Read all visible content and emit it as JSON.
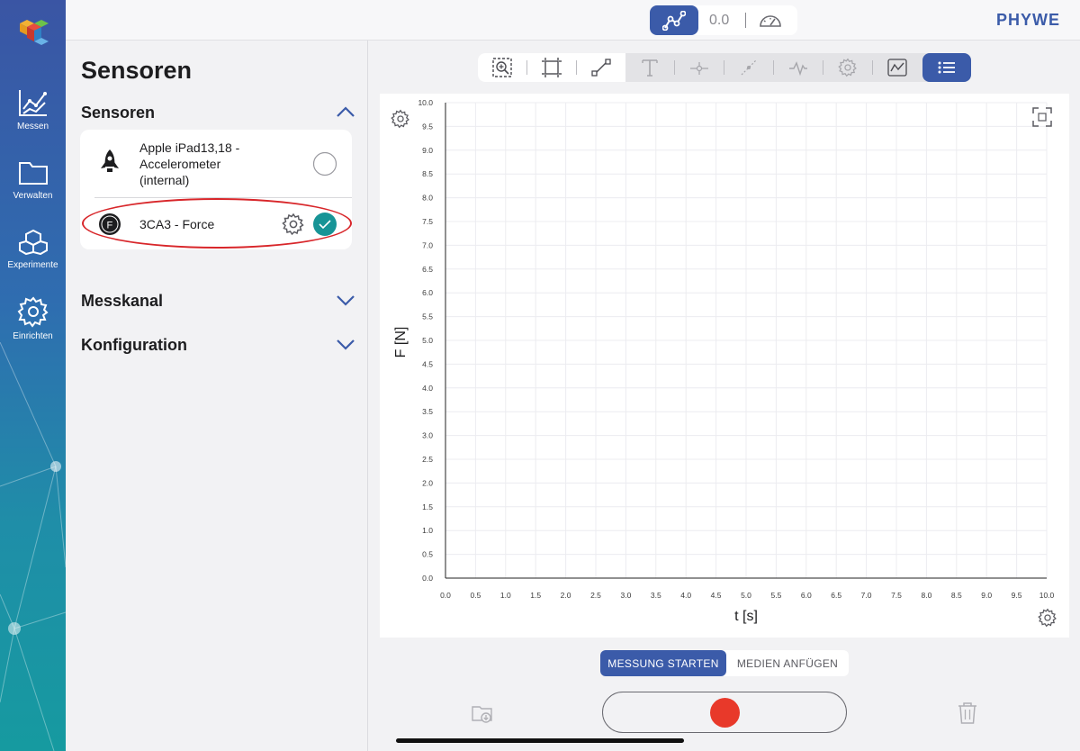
{
  "nav": {
    "items": [
      {
        "label": "Messen",
        "icon": "measure-chart-icon"
      },
      {
        "label": "Verwalten",
        "icon": "folder-icon"
      },
      {
        "label": "Experimente",
        "icon": "experiments-cubes-icon"
      },
      {
        "label": "Einrichten",
        "icon": "gear-icon"
      }
    ]
  },
  "topbar": {
    "live_value": "0.0",
    "brand": "PHYWE"
  },
  "panel": {
    "title": "Sensoren",
    "sections": {
      "sensors": "Sensoren",
      "channel": "Messkanal",
      "config": "Konfiguration"
    },
    "sensors": [
      {
        "line1": "Apple iPad13,18 -",
        "line2": "Accelerometer",
        "line3": "(internal)",
        "selected": false
      },
      {
        "line1": "3CA3 - Force",
        "selected": true
      }
    ]
  },
  "colors": {
    "primary": "#3b5ba9",
    "teal_check": "#179496",
    "record": "#e8392a",
    "highlight": "#d8262a"
  },
  "buttons": {
    "start": "MESSUNG STARTEN",
    "media": "MEDIEN ANFÜGEN"
  },
  "chart_data": {
    "type": "line",
    "xlabel": "t [s]",
    "ylabel": "F [N]",
    "xlim": [
      0,
      10
    ],
    "ylim": [
      0,
      10
    ],
    "x_ticks": [
      "0.0",
      "0.5",
      "1.0",
      "1.5",
      "2.0",
      "2.5",
      "3.0",
      "3.5",
      "4.0",
      "4.5",
      "5.0",
      "5.5",
      "6.0",
      "6.5",
      "7.0",
      "7.5",
      "8.0",
      "8.5",
      "9.0",
      "9.5",
      "10.0"
    ],
    "y_ticks": [
      "0.0",
      "0.5",
      "1.0",
      "1.5",
      "2.0",
      "2.5",
      "3.0",
      "3.5",
      "4.0",
      "4.5",
      "5.0",
      "5.5",
      "6.0",
      "6.5",
      "7.0",
      "7.5",
      "8.0",
      "8.5",
      "9.0",
      "9.5",
      "10.0"
    ],
    "grid": true,
    "series": []
  }
}
